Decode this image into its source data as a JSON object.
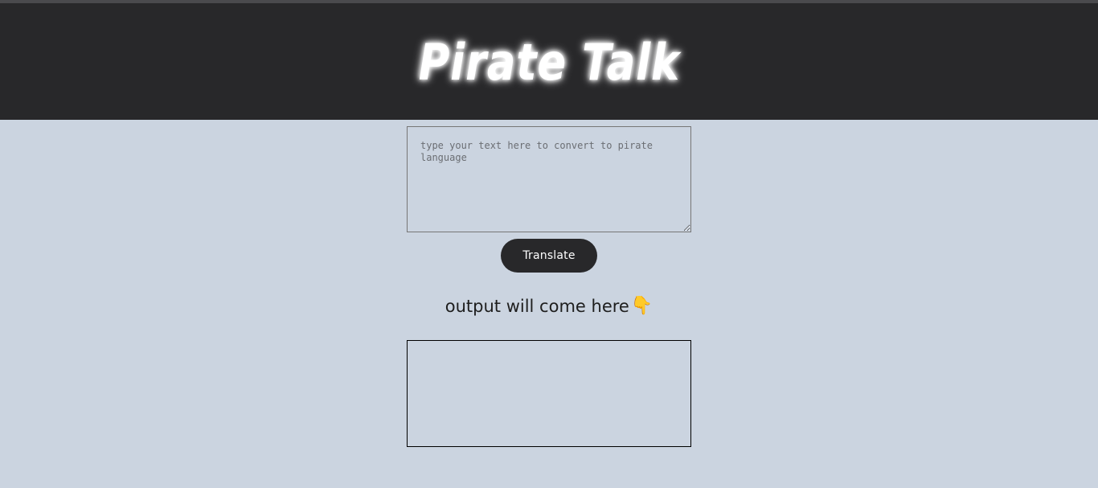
{
  "header": {
    "title": "Pirate Talk"
  },
  "input": {
    "placeholder": "type your text here to convert to pirate language",
    "value": ""
  },
  "translate_button": {
    "label": "Translate"
  },
  "output": {
    "heading": "output will come here",
    "heading_icon": "pointing-down-hand-icon",
    "text": ""
  },
  "colors": {
    "header_bg": "#28282a",
    "page_bg": "#cbd4e0",
    "button_bg": "#28282a",
    "icon_yellow": "#f2b01e"
  }
}
